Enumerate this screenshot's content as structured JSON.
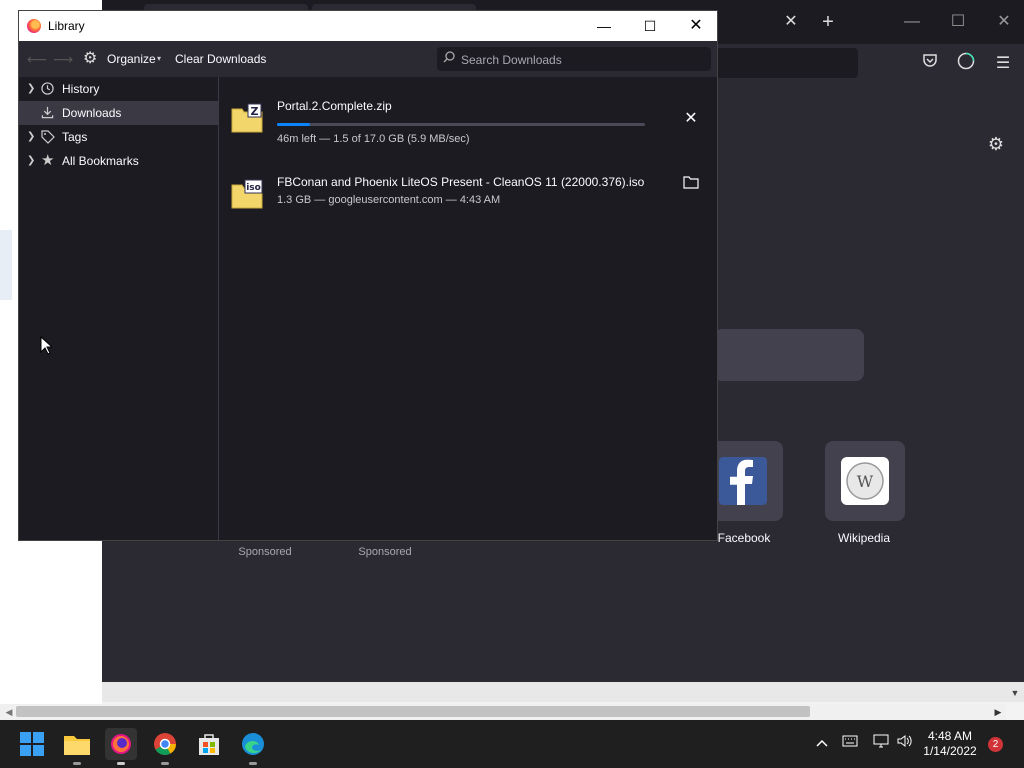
{
  "library": {
    "title": "Library",
    "toolbar": {
      "organize_label": "Organize",
      "clear_downloads_label": "Clear Downloads",
      "search_placeholder": "Search Downloads"
    },
    "sidebar": {
      "items": [
        {
          "label": "History",
          "icon": "clock-icon",
          "expandable": true,
          "selected": false
        },
        {
          "label": "Downloads",
          "icon": "download-icon",
          "expandable": false,
          "selected": true
        },
        {
          "label": "Tags",
          "icon": "tag-icon",
          "expandable": true,
          "selected": false
        },
        {
          "label": "All Bookmarks",
          "icon": "star-icon",
          "expandable": true,
          "selected": false
        }
      ]
    },
    "downloads": [
      {
        "name": "Portal.2.Complete.zip",
        "status": "46m left — 1.5 of 17.0 GB (5.9 MB/sec)",
        "progress": 0.09,
        "action": "cancel",
        "icon": "zip-file-icon"
      },
      {
        "name": "FBConan and Phoenix LiteOS Present - CleanOS 11 (22000.376).iso",
        "status": "1.3 GB — googleusercontent.com — 4:43 AM",
        "action": "show-in-folder",
        "icon": "iso-file-icon"
      }
    ]
  },
  "firefox_newtab": {
    "shortcuts": [
      {
        "label": "Facebook",
        "icon": "facebook-icon"
      },
      {
        "label": "Wikipedia",
        "icon": "wikipedia-icon"
      }
    ],
    "sponsored_labels": [
      "Sponsored",
      "Sponsored"
    ]
  },
  "taskbar": {
    "time": "4:48 AM",
    "date": "1/14/2022",
    "notification_count": "2",
    "apps": [
      "windows-start-icon",
      "file-explorer-icon",
      "firefox-icon",
      "chrome-icon",
      "microsoft-store-icon",
      "edge-icon"
    ]
  },
  "colors": {
    "accent": "#0a84ff",
    "library_bg": "#1c1b22",
    "toolbar_bg": "#2b2a33"
  }
}
